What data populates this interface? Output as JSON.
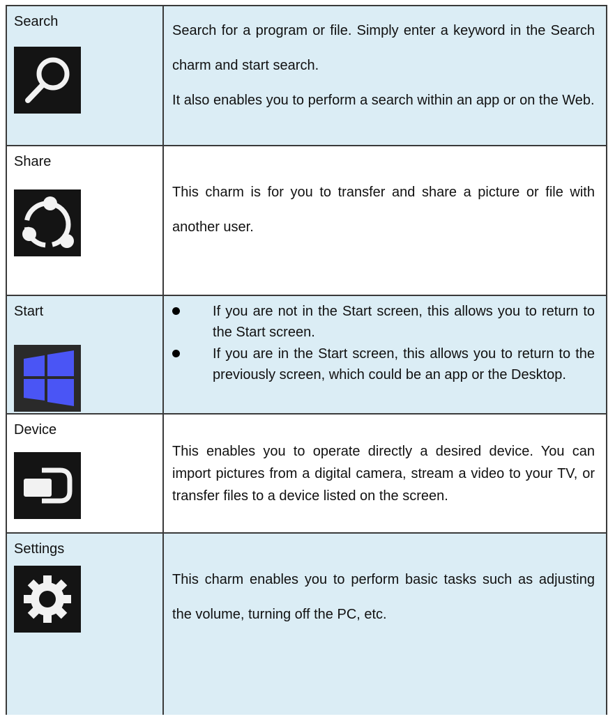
{
  "rows": [
    {
      "name": "Search",
      "icon": "search-icon",
      "paragraphs": [
        "Search for a program or file. Simply enter a keyword in the Search charm and start search.",
        "It also enables you to perform a search within an app or on the Web."
      ]
    },
    {
      "name": "Share",
      "icon": "share-icon",
      "paragraphs": [
        "This charm is for you to transfer and share a picture or file with another user."
      ]
    },
    {
      "name": "Start",
      "icon": "windows-logo-icon",
      "bullets": [
        "If you are not in the Start screen, this allows you to return to the Start screen.",
        "If you are in the Start screen, this allows you to return to the previously screen, which could be an app or the Desktop."
      ]
    },
    {
      "name": "Device",
      "icon": "device-icon",
      "paragraphs": [
        "This enables you to operate directly a desired device. You can import pictures from a digital camera, stream a video to your TV, or transfer files to a device listed on the screen."
      ]
    },
    {
      "name": "Settings",
      "icon": "gear-icon",
      "paragraphs": [
        "This charm enables you to perform basic tasks such as adjusting the volume, turning off the PC, etc."
      ]
    }
  ],
  "colors": {
    "shaded_row": "#dbedf5",
    "icon_background": "#141414",
    "windows_tile": "#4a55f5",
    "border": "#3a3a3a"
  }
}
